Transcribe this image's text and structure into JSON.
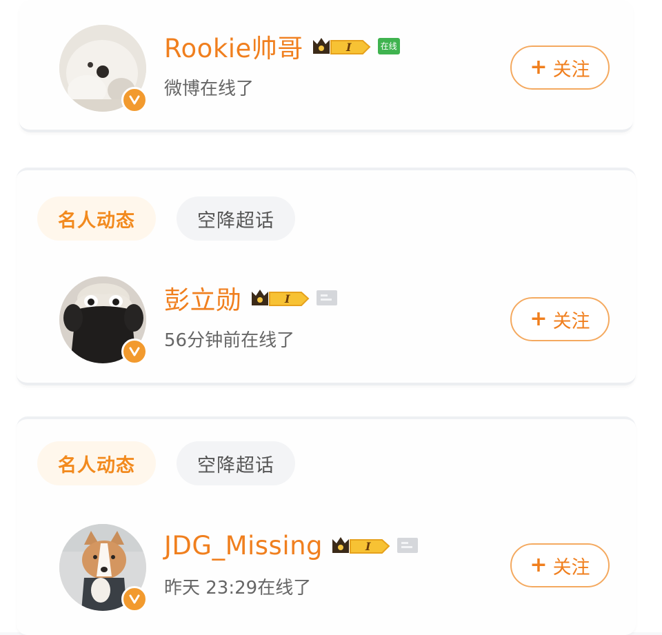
{
  "users": [
    {
      "name": "Rookie帅哥",
      "status_tag": "在线",
      "subtitle": "微博在线了",
      "follow_label": "关注",
      "follow_plus": "+",
      "vip_level": "I"
    },
    {
      "name": "彭立勋",
      "subtitle": "56分钟前在线了",
      "follow_label": "关注",
      "follow_plus": "+",
      "vip_level": "I"
    },
    {
      "name": "JDG_Missing",
      "subtitle": "昨天 23:29在线了",
      "follow_label": "关注",
      "follow_plus": "+",
      "vip_level": "I"
    }
  ],
  "tab_groups": [
    {
      "tabs": [
        {
          "label": "名人动态"
        },
        {
          "label": "空降超话"
        }
      ]
    },
    {
      "tabs": [
        {
          "label": "名人动态"
        },
        {
          "label": "空降超话"
        }
      ]
    }
  ],
  "icons": {
    "verified": "verified-v-badge",
    "vip": "crown-vip-icon",
    "offline_status": "card-status-icon"
  },
  "colors": {
    "accent": "#f07f1e",
    "online_green": "#3fb34f",
    "follow_border": "#f4a95f"
  }
}
